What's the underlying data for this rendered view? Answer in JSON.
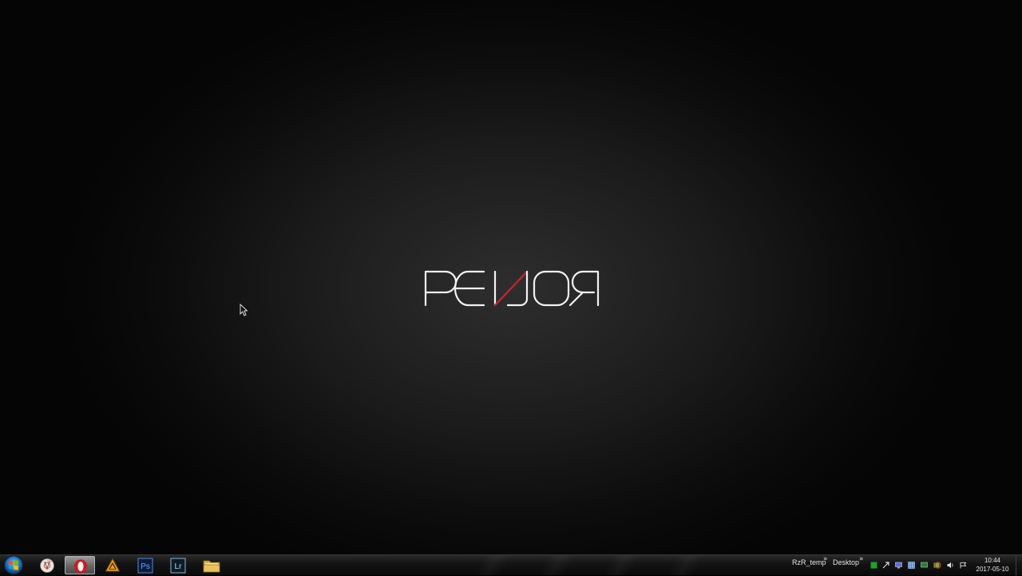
{
  "desktop": {
    "logo_text": "RENOR",
    "accent_color": "#c0262c"
  },
  "taskbar": {
    "start_icon": "windows-orb-icon",
    "pinned": [
      {
        "name": "google-chrome-icon",
        "active": false
      },
      {
        "name": "opera-icon",
        "active": true
      },
      {
        "name": "vlc-media-player-icon",
        "active": false
      },
      {
        "name": "photoshop-icon",
        "label": "Ps",
        "active": false
      },
      {
        "name": "lightroom-icon",
        "label": "Lr",
        "active": false
      },
      {
        "name": "file-explorer-icon",
        "active": false
      }
    ],
    "toolbars": [
      {
        "label": "RzR_temp"
      },
      {
        "label": "Desktop"
      }
    ],
    "chevron": "»",
    "tray_icons": [
      "green-status-icon",
      "network-arrow-icon",
      "monitor-icon",
      "grid-icon",
      "display-icon",
      "green-battery-icon",
      "red-antivirus-icon",
      "volume-icon",
      "action-center-flag-icon"
    ],
    "clock": {
      "time": "10:44",
      "date": "2017-05-10"
    }
  }
}
